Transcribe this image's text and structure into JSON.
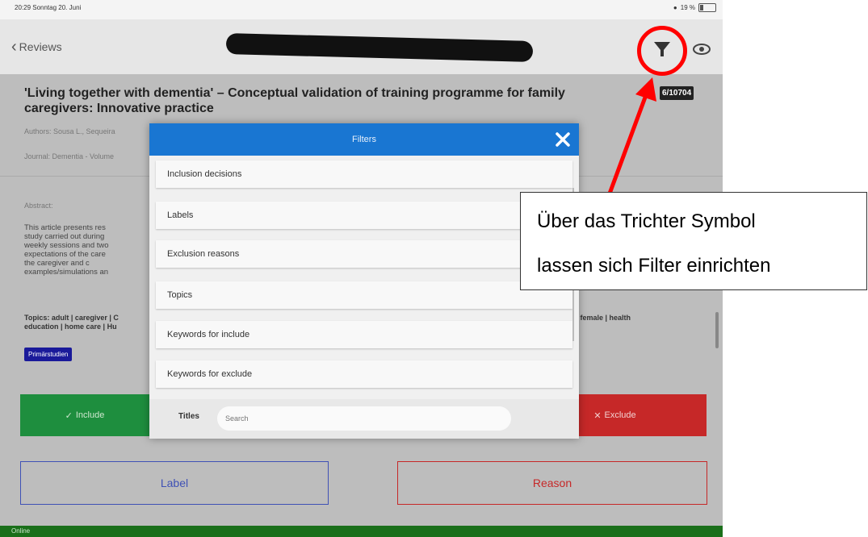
{
  "status_bar": {
    "time": "20:29 Sonntag 20. Juni",
    "battery": "19 %"
  },
  "nav": {
    "back_label": "Reviews",
    "filter_icon": "funnel-icon",
    "view_icon": "eye-icon"
  },
  "article": {
    "title": "'Living together with dementia' – Conceptual validation of training programme for family caregivers: Innovative practice",
    "counter": "6/10704",
    "authors": "Authors: Sousa L., Sequeira",
    "journal": "Journal: Dementia - Volume",
    "abstract_label": "Abstract:",
    "abstract_lines": [
      "This article presents res",
      "study carried out during",
      "weekly sessions and two",
      "expectations of the care",
      "the caregiver and c",
      "examples/simulations an"
    ],
    "topics": "Topics: adult | caregiver | C",
    "topics_line2": "education | home care | Hu",
    "topics_right": "] | female | health",
    "chip": "Primärstudien"
  },
  "actions": {
    "include": "Include",
    "exclude": "Exclude",
    "label": "Label",
    "reason": "Reason"
  },
  "footer": {
    "online": "Online"
  },
  "modal": {
    "title": "Filters",
    "items": [
      "Inclusion decisions",
      "Labels",
      "Exclusion reasons",
      "Topics",
      "Keywords for include",
      "Keywords for exclude"
    ],
    "titles_label": "Titles",
    "search_placeholder": "Search"
  },
  "annotation": {
    "line1": "Über das Trichter Symbol",
    "line2": "lassen sich Filter einrichten",
    "color": "#ff0000"
  }
}
